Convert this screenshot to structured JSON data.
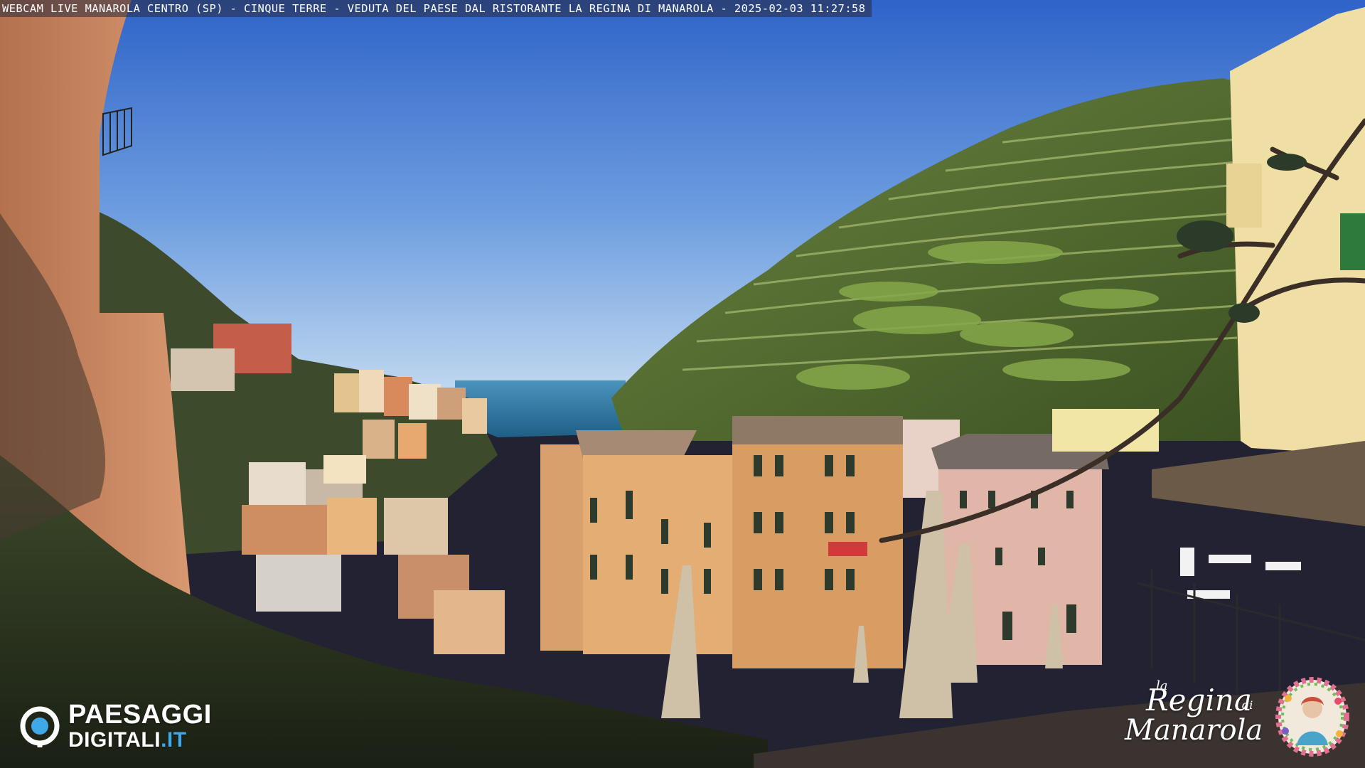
{
  "caption": "WEBCAM LIVE MANAROLA CENTRO (SP) - CINQUE TERRE - VEDUTA DEL PAESE DAL RISTORANTE LA REGINA DI MANAROLA - 2025-02-03 11:27:58",
  "watermark": {
    "line1": "PAESAGGI",
    "line2_main": "DIGITALI",
    "line2_accent": ".IT"
  },
  "brand_logo": {
    "la": "la",
    "regina": "Regina",
    "di": "di",
    "manarola": "Manarola"
  },
  "colors": {
    "sky_top": "#3a6fd0",
    "sky_bottom": "#b9d3ee",
    "sea": "#2f7ea8",
    "hill": "#4f6b2c",
    "terrace": "#7a9a3c",
    "house_ochre": "#d9a66b",
    "house_pink": "#dcb2a4",
    "house_terracotta": "#c97a52",
    "accent_blue": "#3fa9e8"
  }
}
